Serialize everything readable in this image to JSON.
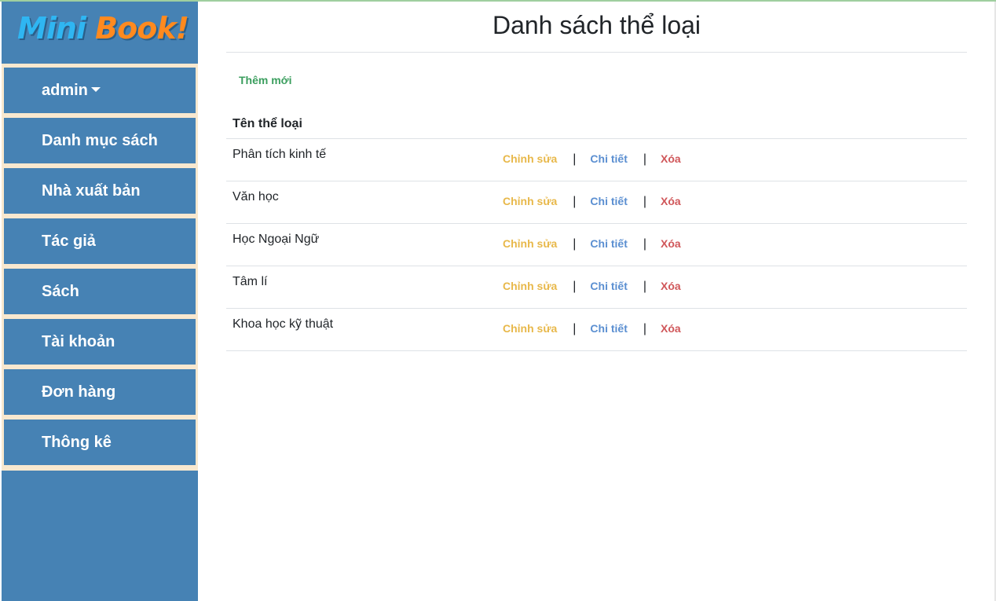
{
  "logo": {
    "part1": "Mini",
    "part2": "Book!"
  },
  "sidebar": {
    "items": [
      {
        "label": "admin"
      },
      {
        "label": "Danh mục sách"
      },
      {
        "label": "Nhà xuất bản"
      },
      {
        "label": "Tác giả"
      },
      {
        "label": "Sách"
      },
      {
        "label": "Tài khoản"
      },
      {
        "label": "Đơn hàng"
      },
      {
        "label": "Thông kê"
      }
    ]
  },
  "main": {
    "title": "Danh sách thể loại",
    "add_new": "Thêm mới",
    "table": {
      "header": "Tên thể loại",
      "rows": [
        {
          "name": "Phân tích kinh tế"
        },
        {
          "name": "Văn học"
        },
        {
          "name": "Học Ngoại Ngữ"
        },
        {
          "name": "Tâm lí"
        },
        {
          "name": "Khoa học kỹ thuật"
        }
      ],
      "actions": {
        "edit": "Chỉnh sửa",
        "detail": "Chi tiết",
        "delete": "Xóa",
        "separator": "|"
      }
    }
  },
  "colors": {
    "sidebar": "#4682b4",
    "menu_gap": "#f8e8cf",
    "edit": "#e8b84a",
    "detail": "#5b8fd1",
    "delete": "#d0575a",
    "add_new": "#3b9e5e"
  }
}
